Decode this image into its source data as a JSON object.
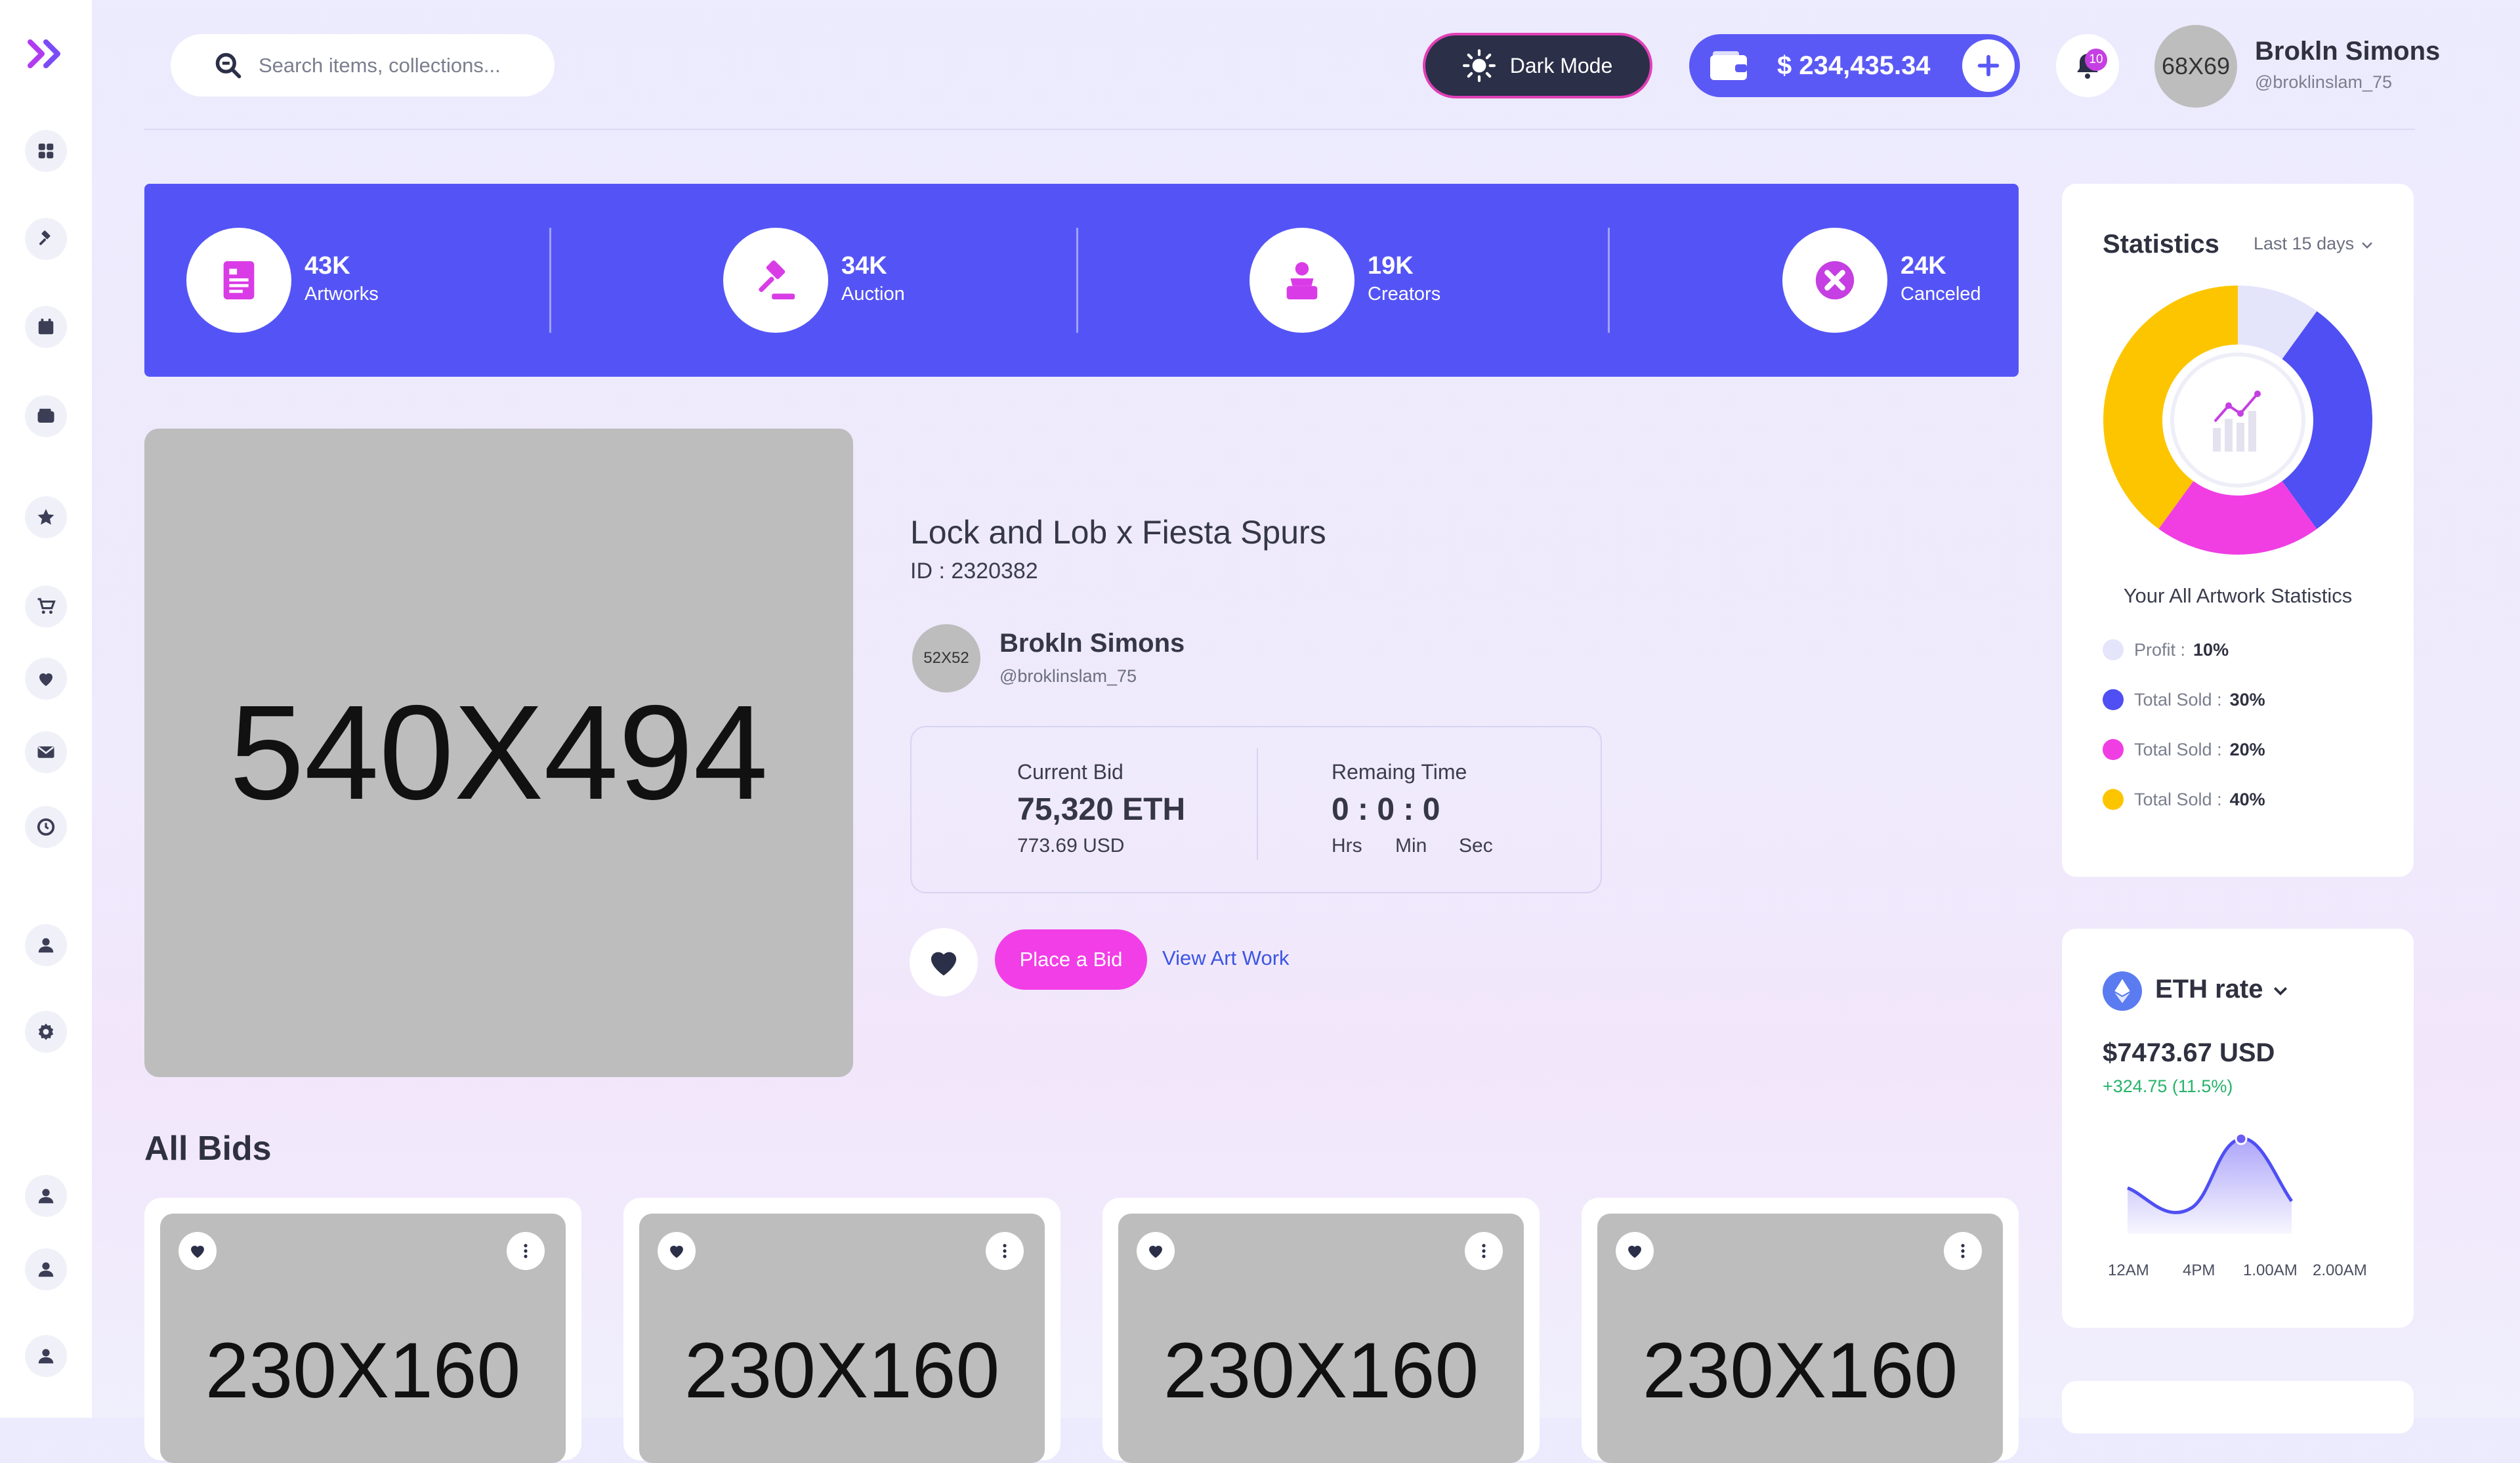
{
  "header": {
    "search_placeholder": "Search items, collections...",
    "dark_mode_label": "Dark Mode",
    "wallet_amount": "$ 234,435.34",
    "notification_count": "10",
    "avatar_placeholder": "68X69",
    "user_name": "Brokln Simons",
    "user_handle": "@broklinslam_75"
  },
  "stats": [
    {
      "value": "43K",
      "label": "Artworks"
    },
    {
      "value": "34K",
      "label": "Auction"
    },
    {
      "value": "19K",
      "label": "Creators"
    },
    {
      "value": "24K",
      "label": "Canceled"
    }
  ],
  "artwork": {
    "image_placeholder": "540X494",
    "title": "Lock and Lob x Fiesta Spurs",
    "id": "ID : 2320382",
    "creator_avatar": "52X52",
    "creator_name": "Brokln Simons",
    "creator_handle": "@broklinslam_75",
    "current_bid_label": "Current Bid",
    "current_bid": "75,320 ETH",
    "current_bid_usd": "773.69 USD",
    "remaining_label": "Remaing Time",
    "remaining_time": "0 : 0 : 0",
    "hrs": "Hrs",
    "min": "Min",
    "sec": "Sec",
    "bid_button": "Place a Bid",
    "view_link": "View Art Work"
  },
  "all_bids": {
    "title": "All Bids",
    "cards": [
      {
        "image": "230X160"
      },
      {
        "image": "230X160"
      },
      {
        "image": "230X160"
      },
      {
        "image": "230X160"
      }
    ]
  },
  "statistics": {
    "title": "Statistics",
    "period": "Last 15 days",
    "subtitle": "Your All Artwork Statistics",
    "legend": [
      {
        "label": "Profit :",
        "pct": "10%",
        "color": "#e4e4fb"
      },
      {
        "label": "Total Sold :",
        "pct": "30%",
        "color": "#4f4ff3"
      },
      {
        "label": "Total Sold :",
        "pct": "20%",
        "color": "#f03ee3"
      },
      {
        "label": "Total Sold :",
        "pct": "40%",
        "color": "#fdc500"
      }
    ]
  },
  "eth": {
    "title": "ETH rate",
    "price": "$7473.67 USD",
    "change": "+324.75 (11.5%)",
    "ticks": [
      "12AM",
      "4PM",
      "1.00AM",
      "2.00AM"
    ]
  },
  "colors": {
    "accent": "#5454f6",
    "pink": "#f23ee6",
    "sidebar_icon": "#3b3e54"
  }
}
